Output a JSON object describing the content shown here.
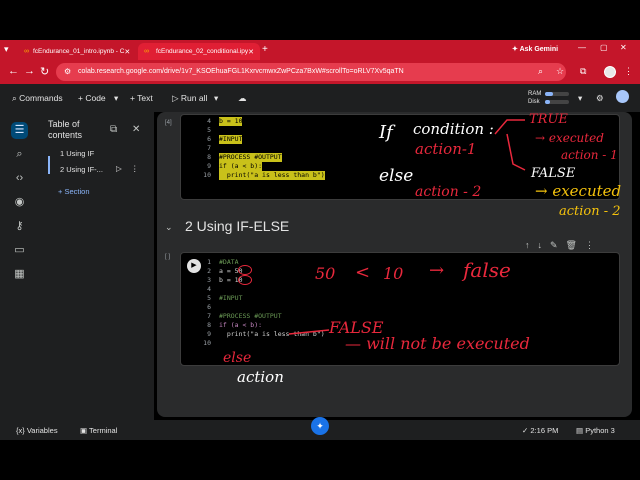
{
  "browser": {
    "tab1_title": "fcEndurance_01_intro.ipynb - C",
    "tab2_title": "fcEndurance_02_conditional.ipy",
    "new_tab": "+",
    "ask_gemini": "Ask Gemini",
    "url": "colab.research.google.com/drive/1v7_KSOEhuaFGL1KxrvcmwxZwPCza7BxW#scrollTo=oRLV7Xv5qaTN"
  },
  "toolbar": {
    "commands": "Commands",
    "code": "+ Code",
    "text": "+ Text",
    "run_all": "Run all",
    "ram": "RAM",
    "disk": "Disk",
    "ram_usage": 0.35,
    "disk_usage": 0.2
  },
  "toc": {
    "title_line1": "Table of",
    "title_line2": "contents",
    "sections": [
      "1 Using IF",
      "2 Using IF-...",
      "Section"
    ],
    "add_section": "Section"
  },
  "cell1": {
    "number": "[4]",
    "lines": [
      {
        "n": "4",
        "text": "b = 10"
      },
      {
        "n": "5",
        "text": ""
      },
      {
        "n": "6",
        "text": "#INPUT"
      },
      {
        "n": "7",
        "text": ""
      },
      {
        "n": "8",
        "text": "#PROCESS #OUTPUT"
      },
      {
        "n": "9",
        "text": "if (a < b):"
      },
      {
        "n": "10",
        "text": "  print(\"a is less than b\")"
      }
    ]
  },
  "heading2": "2 Using IF-ELSE",
  "cell2": {
    "number": "[ ]",
    "lines": [
      {
        "n": "1",
        "text": "#DATA"
      },
      {
        "n": "2",
        "text": "a = 50"
      },
      {
        "n": "3",
        "text": "b = 10"
      },
      {
        "n": "4",
        "text": ""
      },
      {
        "n": "5",
        "text": "#INPUT"
      },
      {
        "n": "6",
        "text": ""
      },
      {
        "n": "7",
        "text": "#PROCESS #OUTPUT"
      },
      {
        "n": "8",
        "text": "if (a < b):"
      },
      {
        "n": "9",
        "text": "  print(\"a is less than b\")"
      },
      {
        "n": "10",
        "text": ""
      }
    ]
  },
  "annotations": {
    "if": "If",
    "condition": "condition :",
    "action1": "action-1",
    "else": "else",
    "action2": "action - 2",
    "true": "TRUE",
    "executed1": "→ executed",
    "action_1b": "action - 1",
    "false": "FALSE",
    "executed2": "→ executed",
    "action_2b": "action - 2",
    "n50": "50",
    "lt": "<",
    "n10": "10",
    "arrow": "→",
    "false2": "false",
    "false3": "FALSE",
    "will_not": "— will not be executed",
    "else2": "else",
    "action_w": "action"
  },
  "status": {
    "variables": "Variables",
    "terminal": "Terminal",
    "time": "2:16 PM",
    "runtime": "Python 3"
  },
  "colors": {
    "tabbar": "#c4162a",
    "highlight": "#c9c11a",
    "annotation_red": "#e8283c",
    "annotation_yellow": "#f4c20d"
  }
}
